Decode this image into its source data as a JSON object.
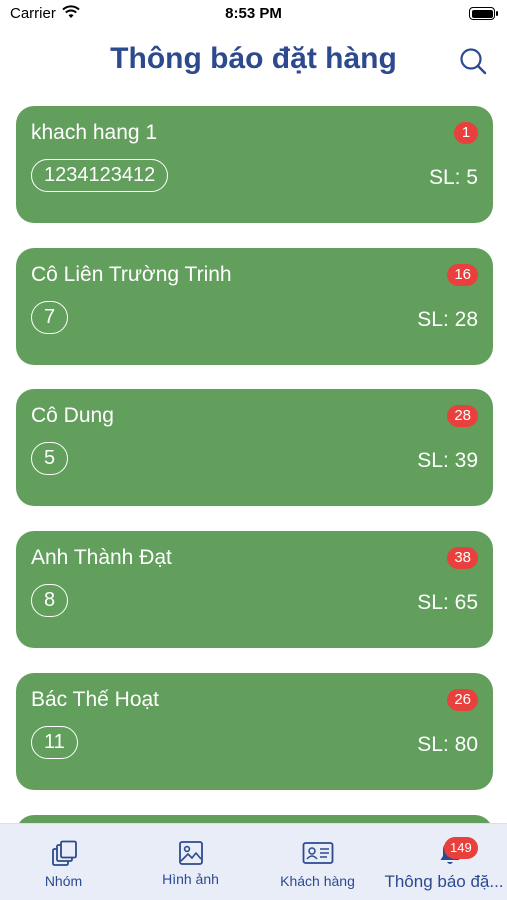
{
  "status_bar": {
    "carrier": "Carrier",
    "time": "8:53 PM"
  },
  "header": {
    "title": "Thông báo đặt hàng"
  },
  "orders": [
    {
      "name": "khach hang 1",
      "badge": "1",
      "code": "1234123412",
      "qty": "SL: 5"
    },
    {
      "name": "Cô Liên Trường Trinh",
      "badge": "16",
      "code": "7",
      "qty": "SL: 28"
    },
    {
      "name": "Cô Dung",
      "badge": "28",
      "code": "5",
      "qty": "SL: 39"
    },
    {
      "name": "Anh Thành Đạt",
      "badge": "38",
      "code": "8",
      "qty": "SL: 65"
    },
    {
      "name": "Bác Thế Hoạt",
      "badge": "26",
      "code": "11",
      "qty": "SL: 80"
    }
  ],
  "tabbar": {
    "tabs": [
      {
        "label": "Nhóm",
        "icon": "stack-icon"
      },
      {
        "label": "Hình ảnh",
        "icon": "image-icon"
      },
      {
        "label": "Khách hàng",
        "icon": "contact-card-icon"
      },
      {
        "label": "Thông báo đặ...",
        "icon": "bell-icon",
        "badge": "149"
      }
    ]
  },
  "colors": {
    "card": "#629f5d",
    "badge": "#e8403d",
    "title": "#2d4a8f",
    "tabbar": "#e8edf8"
  }
}
